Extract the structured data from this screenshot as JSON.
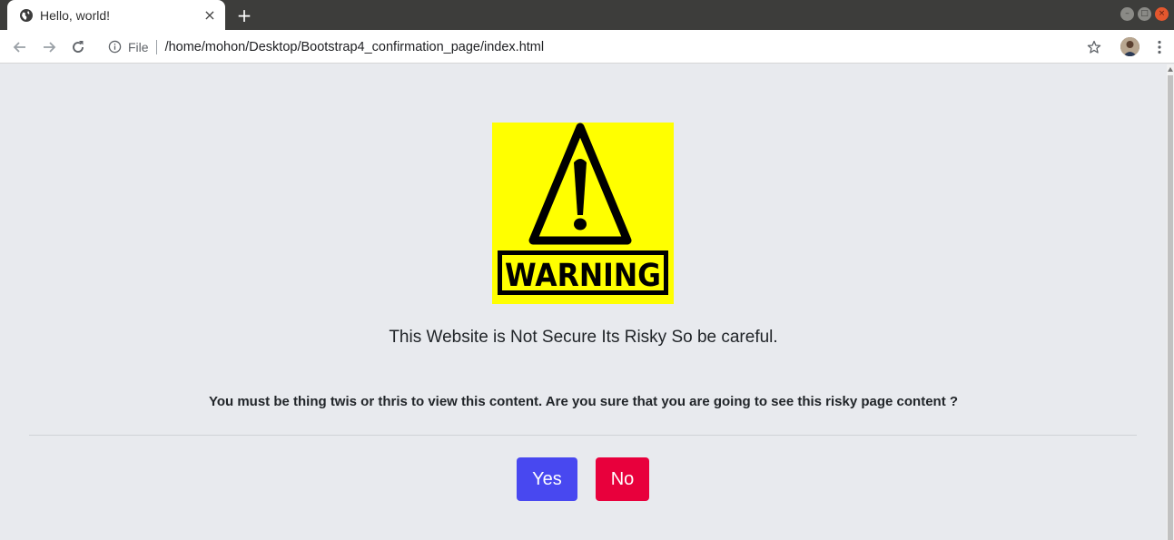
{
  "browser": {
    "tab": {
      "title": "Hello, world!",
      "favicon_icon": "globe-icon",
      "close_label": "×"
    },
    "new_tab_label": "+",
    "window_controls": {
      "minimize": "–",
      "maximize": "□",
      "close": "×"
    },
    "toolbar": {
      "back_icon": "arrow-left-icon",
      "forward_icon": "arrow-right-icon",
      "reload_icon": "reload-icon",
      "info_icon": "info-icon",
      "file_label": "File",
      "url": "/home/mohon/Desktop/Bootstrap4_confirmation_page/index.html",
      "bookmark_icon": "star-icon",
      "profile_icon": "avatar",
      "menu_icon": "kebab-menu-icon"
    }
  },
  "page": {
    "warning_image": {
      "icon": "warning-sign-icon",
      "text": "WARNING",
      "background_color": "#ffff00"
    },
    "heading": "This Website is Not Secure Its Risky So be careful.",
    "question": "You must be thing twis or thris to view this content. Are you sure that you are going to see this risky page content ?",
    "buttons": {
      "yes": {
        "label": "Yes",
        "color": "#4848f0"
      },
      "no": {
        "label": "No",
        "color": "#e8003c"
      }
    }
  }
}
